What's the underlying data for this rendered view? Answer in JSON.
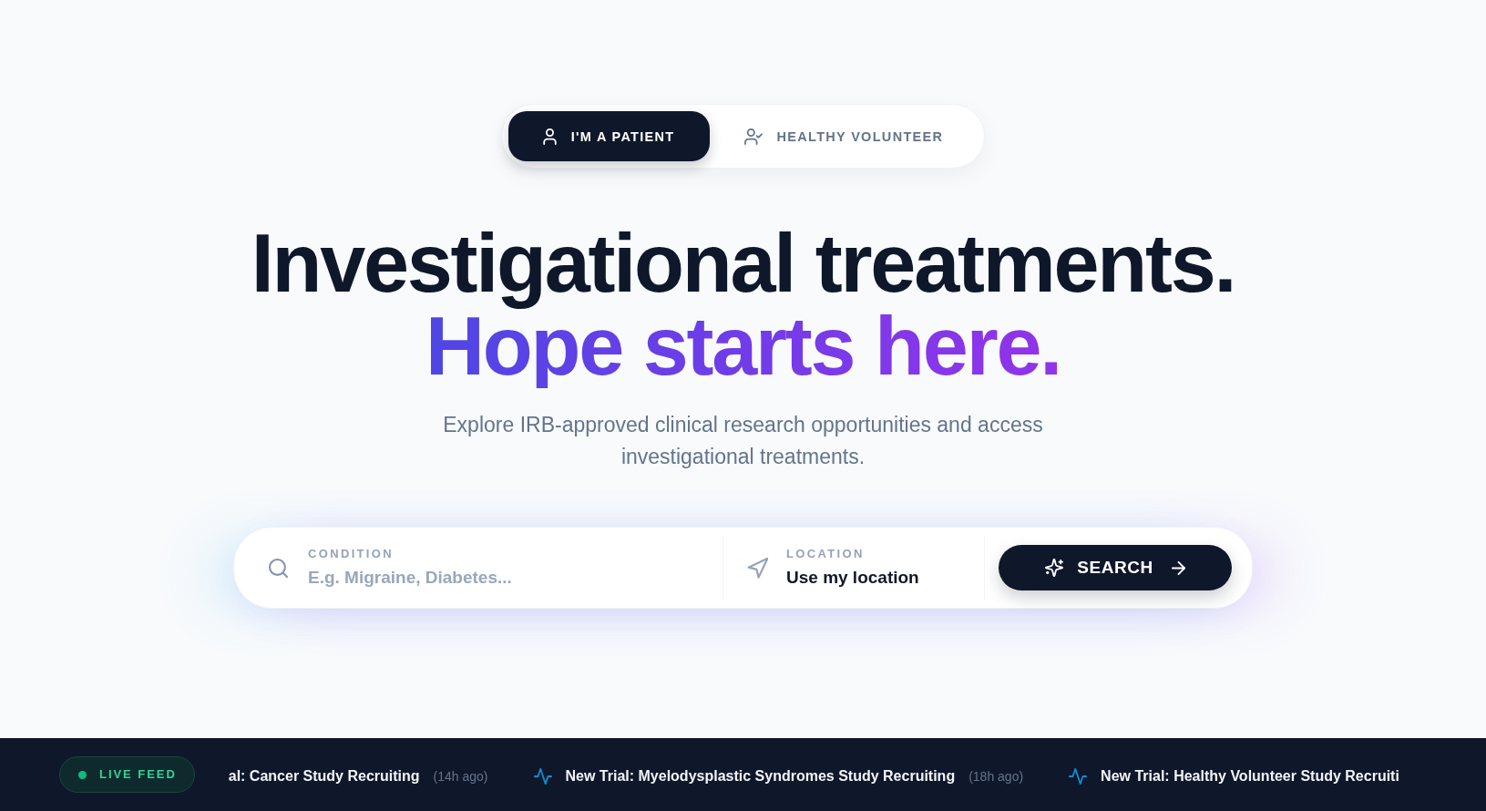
{
  "audience_tabs": [
    {
      "label": "I'M A PATIENT",
      "kind": "patient",
      "selected": true
    },
    {
      "label": "HEALTHY VOLUNTEER",
      "kind": "volunteer",
      "selected": false
    }
  ],
  "hero": {
    "headline": "Investigational treatments.",
    "highlight": "Hope starts here.",
    "subtitle": "Explore IRB-approved clinical research opportunities and access investigational treatments."
  },
  "search_bar": {
    "condition": {
      "label": "CONDITION",
      "placeholder": "E.g. Migraine, Diabetes..."
    },
    "location": {
      "label": "LOCATION",
      "value": "Use my location"
    },
    "button": "SEARCH"
  },
  "live_feed": {
    "badge": "LIVE FEED",
    "items": [
      {
        "title": "al: Cancer Study Recruiting",
        "time": "(14h ago)",
        "pulse_icon": false
      },
      {
        "title": "New Trial: Myelodysplastic Syndromes Study Recruiting",
        "time": "(18h ago)",
        "pulse_icon": true
      },
      {
        "title": "New Trial: Healthy Volunteer Study Recruiti",
        "pulse_icon": true
      }
    ]
  }
}
